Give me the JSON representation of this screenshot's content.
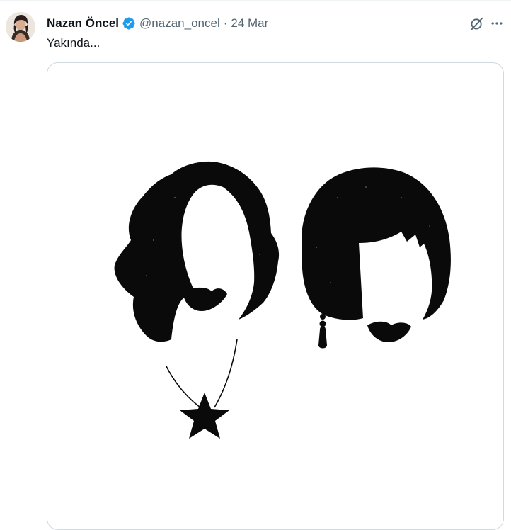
{
  "tweet": {
    "author_name": "Nazan Öncel",
    "handle": "@nazan_oncel",
    "separator": "·",
    "date": "24 Mar",
    "verified": true,
    "text": "Yakında..."
  },
  "icons": {
    "verified": "verified-badge-icon",
    "grok": "grok-icon",
    "more": "more-icon"
  },
  "colors": {
    "name": "#0f1419",
    "meta": "#536471",
    "verified_badge": "#1d9bf0",
    "border": "#cfd9de",
    "illustration": "#0a0a0a"
  }
}
